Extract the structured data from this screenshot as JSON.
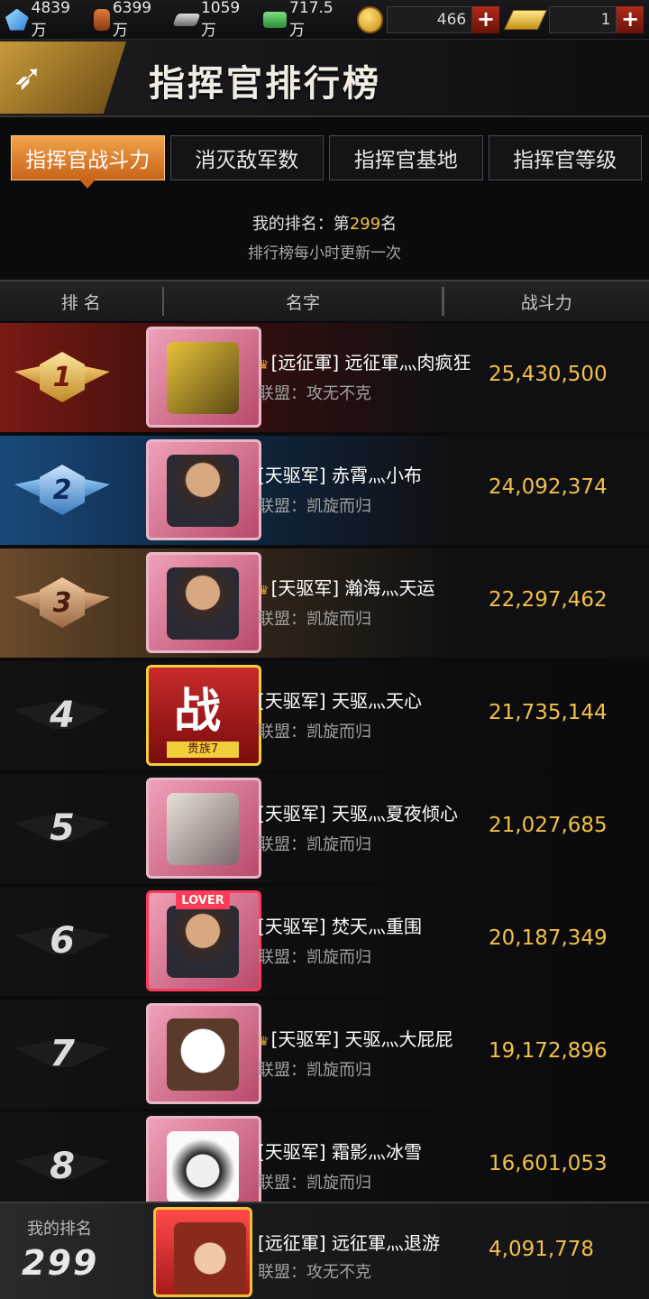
{
  "resources": [
    {
      "icon": "crystal-icon",
      "value": "4839万"
    },
    {
      "icon": "oil-barrel-icon",
      "value": "6399万"
    },
    {
      "icon": "steel-icon",
      "value": "1059万"
    },
    {
      "icon": "cash-icon",
      "value": "717.5万"
    }
  ],
  "currency": {
    "coins": {
      "icon": "coin-icon",
      "value": "466",
      "add": "+"
    },
    "gold": {
      "icon": "gold-bar-icon",
      "value": "1",
      "add": "+"
    }
  },
  "header": {
    "title": "指挥官排行榜",
    "emblem_icon": "eagle-icon"
  },
  "tabs": [
    {
      "label": "指挥官战斗力",
      "active": true
    },
    {
      "label": "消灭敌军数",
      "active": false
    },
    {
      "label": "指挥官基地",
      "active": false
    },
    {
      "label": "指挥官等级",
      "active": false
    }
  ],
  "my_rank": {
    "prefix": "我的排名：第",
    "rank": "299",
    "suffix": "名"
  },
  "update_note": "排行榜每小时更新一次",
  "columns": {
    "rank": "排 名",
    "name": "名字",
    "power": "战斗力"
  },
  "rows": [
    {
      "rank": "1",
      "name": "[远征軍] 远征軍灬肉疯狂",
      "alliance": "联盟：攻无不克",
      "power": "25,430,500",
      "avatar": "mech",
      "vip": true
    },
    {
      "rank": "2",
      "name": "[天驱军] 赤霄灬小布",
      "alliance": "联盟：凯旋而归",
      "power": "24,092,374",
      "avatar": "man",
      "vip": false
    },
    {
      "rank": "3",
      "name": "[天驱军] 瀚海灬天运",
      "alliance": "联盟：凯旋而归",
      "power": "22,297,462",
      "avatar": "man",
      "vip": true
    },
    {
      "rank": "4",
      "name": "[天驱军] 天驱灬天心",
      "alliance": "联盟：凯旋而归",
      "power": "21,735,144",
      "avatar": "war",
      "vip": false,
      "avatar_text": "战",
      "avatar_tag": "贵族7"
    },
    {
      "rank": "5",
      "name": "[天驱军] 天驱灬夏夜倾心",
      "alliance": "联盟：凯旋而归",
      "power": "21,027,685",
      "avatar": "art",
      "vip": false
    },
    {
      "rank": "6",
      "name": "[天驱军] 焚天灬重围",
      "alliance": "联盟：凯旋而归",
      "power": "20,187,349",
      "avatar": "lover",
      "vip": false,
      "avatar_text": "LOVER"
    },
    {
      "rank": "7",
      "name": "[天驱军] 天驱灬大屁屁",
      "alliance": "联盟：凯旋而归",
      "power": "19,172,896",
      "avatar": "robot",
      "vip": true
    },
    {
      "rank": "8",
      "name": "[天驱军] 霜影灬冰雪",
      "alliance": "联盟：凯旋而归",
      "power": "16,601,053",
      "avatar": "girl",
      "vip": false
    }
  ],
  "me": {
    "label": "我的排名",
    "rank": "299",
    "name": "[远征軍] 远征軍灬退游",
    "alliance": "联盟：攻无不克",
    "power": "4,091,778"
  }
}
